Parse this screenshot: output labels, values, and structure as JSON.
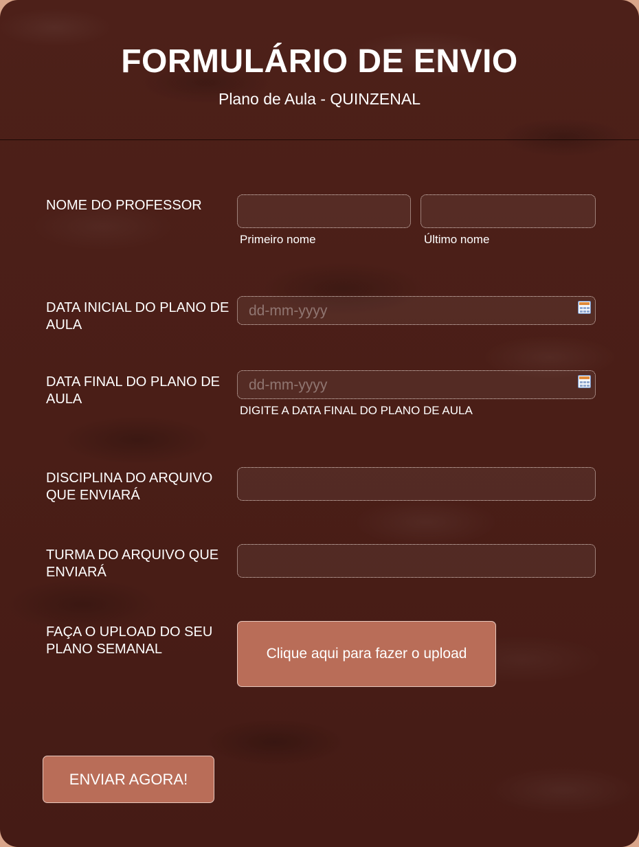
{
  "header": {
    "title": "FORMULÁRIO DE ENVIO",
    "subtitle": "Plano de Aula - QUINZENAL"
  },
  "fields": {
    "teacher_name": {
      "label": "NOME DO PROFESSOR",
      "first_name_value": "",
      "first_name_sublabel": "Primeiro nome",
      "last_name_value": "",
      "last_name_sublabel": "Último nome"
    },
    "start_date": {
      "label": "DATA INICIAL DO PLANO DE AULA",
      "placeholder": "dd-mm-yyyy"
    },
    "end_date": {
      "label": "DATA FINAL DO PLANO DE AULA",
      "placeholder": "dd-mm-yyyy",
      "hint": "DIGITE A DATA FINAL DO PLANO DE AULA"
    },
    "subject": {
      "label": "DISCIPLINA DO ARQUIVO QUE ENVIARÁ",
      "value": ""
    },
    "class_group": {
      "label": "TURMA DO ARQUIVO QUE ENVIARÁ",
      "value": ""
    },
    "upload": {
      "label": "FAÇA O UPLOAD DO SEU PLANO SEMANAL",
      "button_label": "Clique aqui para fazer o upload"
    }
  },
  "submit": {
    "label": "ENVIAR AGORA!"
  },
  "colors": {
    "background": "#4a1f18",
    "button": "#b96d58",
    "text": "#ffffff",
    "outer": "#d9a58a"
  },
  "icons": {
    "date_picker": "calendar-icon"
  }
}
